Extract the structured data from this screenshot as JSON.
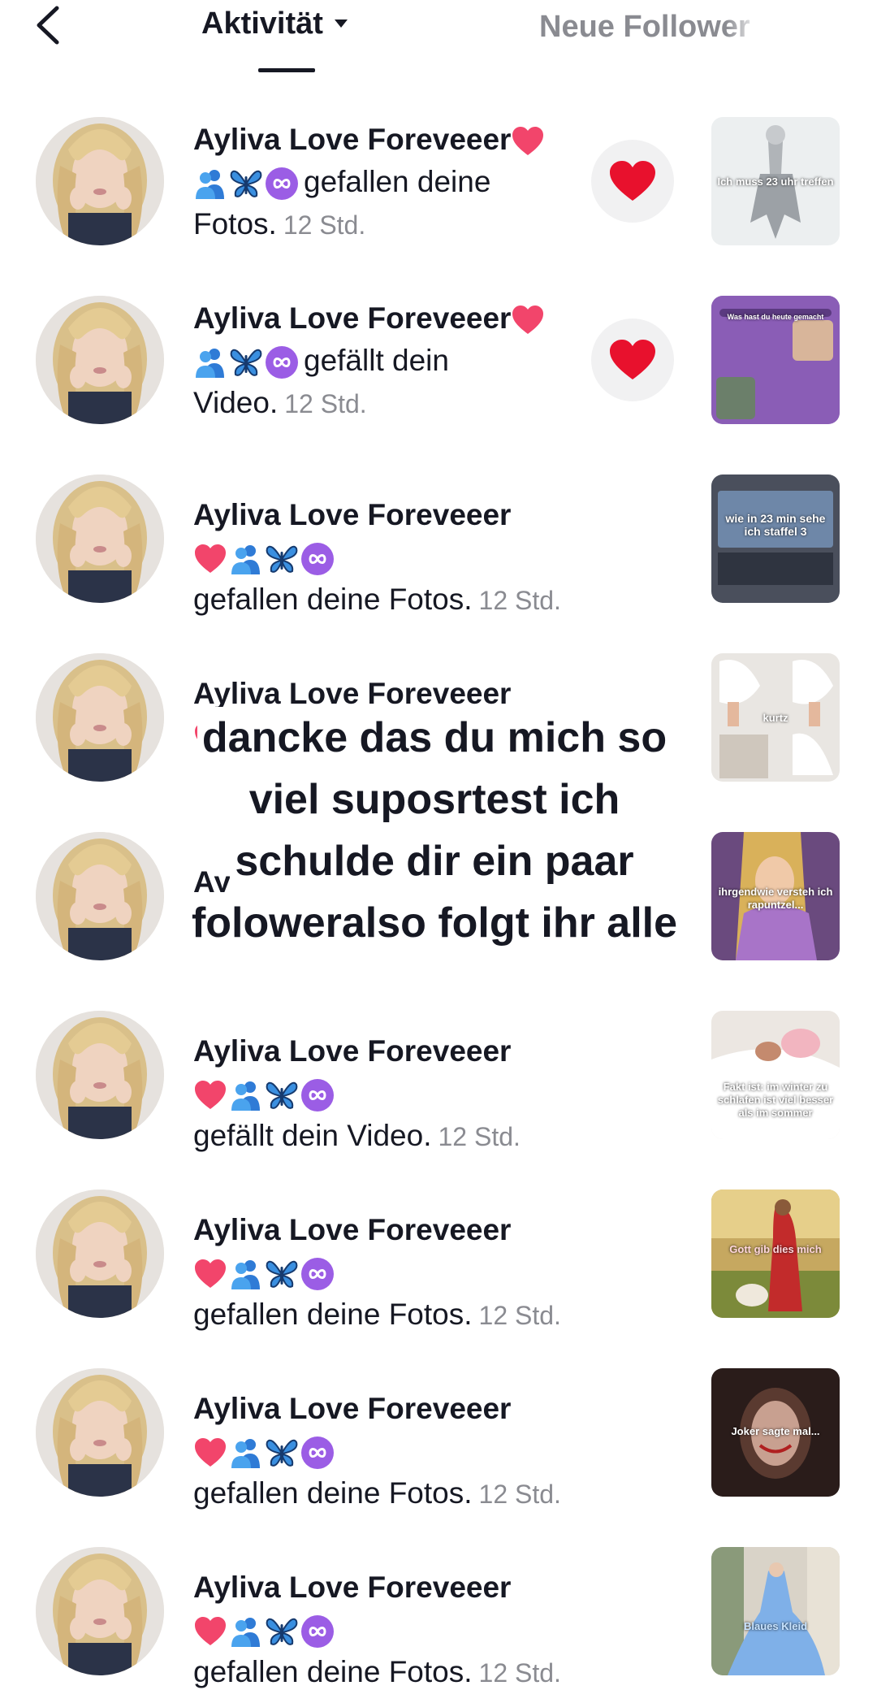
{
  "header": {
    "tab_activity": "Aktivität",
    "tab_followers": "Neue Follower"
  },
  "colors": {
    "heart": "#fe2c55",
    "text": "#161823",
    "muted": "#8a8b91"
  },
  "icons": {
    "back": "chevron-left-icon",
    "caret": "caret-down-icon",
    "like": "heart-icon"
  },
  "rows": [
    {
      "username": "Ayliva Love Foreveeer",
      "action": "gefallen deine",
      "action_tail": "Fotos.",
      "time": "12 Std.",
      "thumb_caption": "Ich muss 23 uhr treffen"
    },
    {
      "username": "Ayliva Love Foreveeer",
      "action": "gefällt dein",
      "action_tail": "Video.",
      "time": "12 Std.",
      "thumb_caption": "Was hast du heute gemacht"
    },
    {
      "username": "Ayliva Love Foreveeer",
      "action": "gefallen deine Fotos.",
      "time": "12 Std.",
      "thumb_caption": "wie in 23 min sehe ich staffel 3"
    },
    {
      "username": "Ayliva Love Foreveeer",
      "action": "",
      "time": "",
      "thumb_caption": "kurtz"
    },
    {
      "username": "Ay",
      "action": "",
      "time": "",
      "thumb_caption": "ihrgendwie versteh ich rapuntzel..."
    },
    {
      "username": "Ayliva Love Foreveeer",
      "action": "gefällt dein Video.",
      "time": "12 Std.",
      "thumb_caption": "Fakt ist: im winter zu schlafen ist viel besser als im sommer"
    },
    {
      "username": "Ayliva Love Foreveeer",
      "action": "gefallen deine Fotos.",
      "time": "12 Std.",
      "thumb_caption": "Gott gib dies mich"
    },
    {
      "username": "Ayliva Love Foreveeer",
      "action": "gefallen deine Fotos.",
      "time": "12 Std.",
      "thumb_caption": "Joker sagte mal..."
    },
    {
      "username": "Ayliva Love Foreveeer",
      "action": "gefallen deine Fotos.",
      "time": "12 Std.",
      "thumb_caption": "Blaues Kleid"
    }
  ],
  "overlay": {
    "line1": "dancke das du mich so",
    "line2": "viel suposrtest ich",
    "line3": "schulde dir ein paar",
    "line4": "foloweralso folgt ihr alle"
  }
}
